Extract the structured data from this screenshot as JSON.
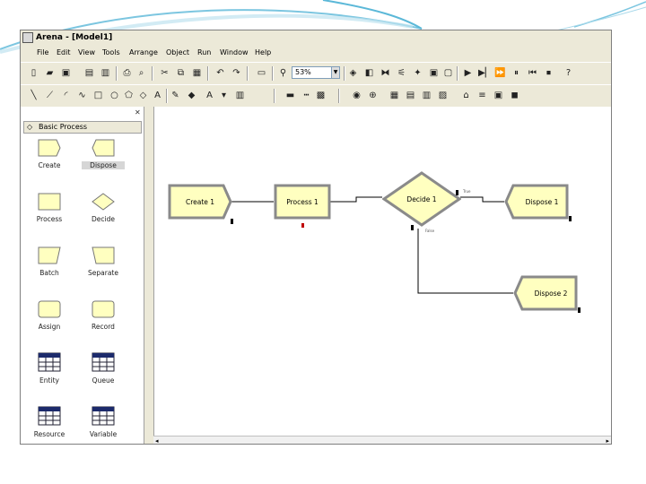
{
  "app": {
    "title": "Arena - [Model1]"
  },
  "menu": [
    "File",
    "Edit",
    "View",
    "Tools",
    "Arrange",
    "Object",
    "Run",
    "Window",
    "Help"
  ],
  "toolbar": {
    "zoom_value": "53%"
  },
  "panel": {
    "title": "Basic Process",
    "modules": [
      "Create",
      "Dispose",
      "Process",
      "Decide",
      "Batch",
      "Separate",
      "Assign",
      "Record",
      "Entity",
      "Queue",
      "Resource",
      "Variable"
    ]
  },
  "flowchart": {
    "create": "Create 1",
    "process": "Process 1",
    "decide": "Decide 1",
    "dispose1": "Dispose 1",
    "dispose2": "Dispose 2",
    "true_label": "True",
    "false_label": "False"
  },
  "colors": {
    "module_fill": "#ffffc0",
    "module_border": "#8a8a8a",
    "panel_bg": "#ece9d8",
    "accent_swoosh": "#5bb8d8"
  }
}
